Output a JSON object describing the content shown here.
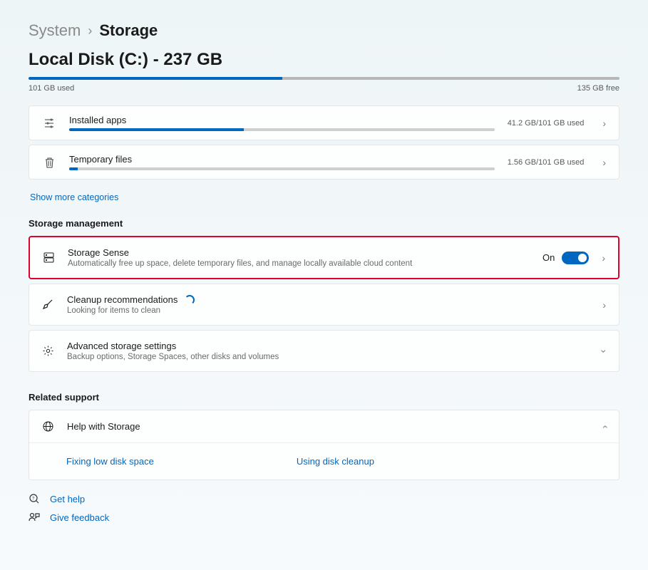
{
  "breadcrumb": {
    "parent": "System",
    "sep": "›",
    "current": "Storage"
  },
  "disk": {
    "title": "Local Disk (C:) - 237 GB",
    "used_label": "101 GB used",
    "free_label": "135 GB free",
    "used_percent": 43
  },
  "categories": [
    {
      "title": "Installed apps",
      "usage": "41.2 GB/101 GB used",
      "percent": 41
    },
    {
      "title": "Temporary files",
      "usage": "1.56 GB/101 GB used",
      "percent": 2
    }
  ],
  "show_more": "Show more categories",
  "sections": {
    "management": "Storage management",
    "support": "Related support"
  },
  "storage_sense": {
    "title": "Storage Sense",
    "sub": "Automatically free up space, delete temporary files, and manage locally available cloud content",
    "state": "On"
  },
  "cleanup": {
    "title": "Cleanup recommendations",
    "sub": "Looking for items to clean"
  },
  "advanced": {
    "title": "Advanced storage settings",
    "sub": "Backup options, Storage Spaces, other disks and volumes"
  },
  "help_storage": {
    "title": "Help with Storage"
  },
  "help_links": {
    "a": "Fixing low disk space",
    "b": "Using disk cleanup"
  },
  "footer": {
    "help": "Get help",
    "feedback": "Give feedback"
  }
}
